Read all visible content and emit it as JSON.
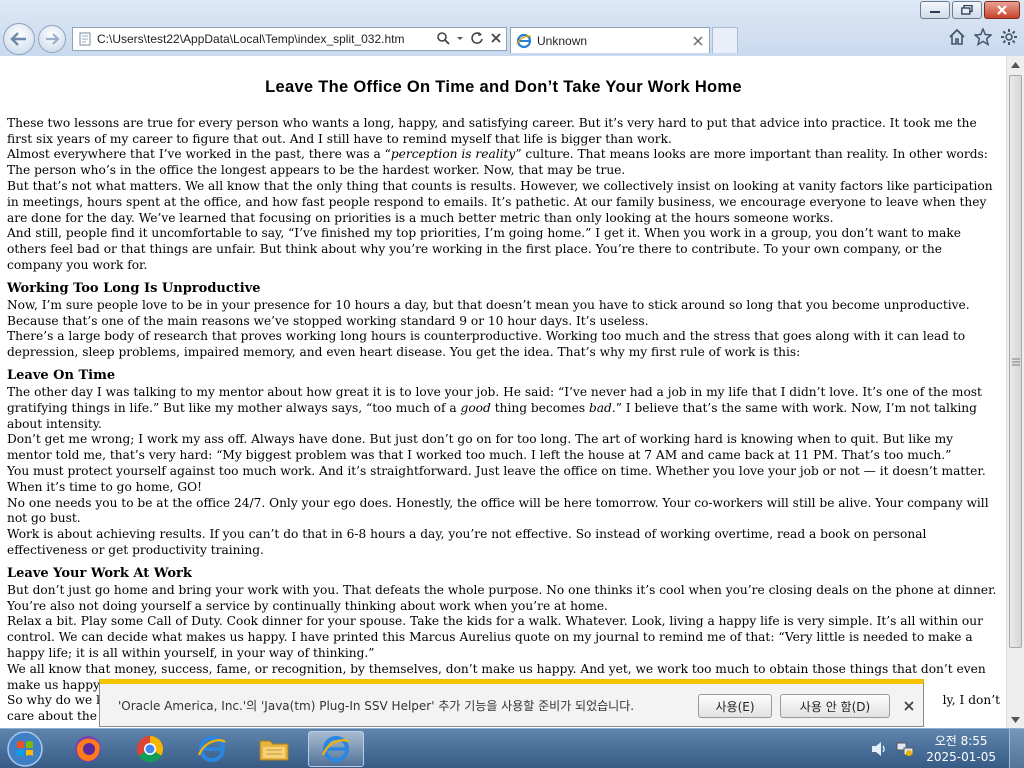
{
  "browser": {
    "address": "C:\\Users\\test22\\AppData\\Local\\Temp\\index_split_032.htm",
    "tab_title": "Unknown",
    "colors": {
      "chrome": "#c9d9ee",
      "close_button": "#c8432c",
      "notification_accent": "#f3c200"
    }
  },
  "article": {
    "title": "Leave The Office On Time and Don’t Take Your Work Home",
    "intro": [
      "These two lessons are true for every person who wants a long, happy, and satisfying career. But it’s very hard to put that advice into practice. It took me the first six years of my career to figure that out. And I still have to remind myself that life is bigger than work.",
      "Almost everywhere that I’ve worked in the past, there was a “",
      "perception is reality",
      "” culture. That means looks are more important than reality. In other words: The person who’s in the office the longest appears to be the hardest worker. Now, that may be true.",
      "But that’s not what matters. We all know that the only thing that counts is results. However, we collectively insist on looking at vanity factors like participation in meetings, hours spent at the office, and how fast people respond to emails. It’s pathetic. At our family business, we encourage everyone to leave when they are done for the day. We’ve learned that focusing on priorities is a much better metric than only looking at the hours someone works.",
      "And still, people find it uncomfortable to say, “I’ve finished my top priorities, I’m going home.” I get it. When you work in a group, you don’t want to make others feel bad or that things are unfair. But think about why you’re working in the first place. You’re there to contribute. To your own company, or the company you work for."
    ],
    "section1": {
      "heading": "Working Too Long Is Unproductive",
      "p1": "Now, I’m sure people love to be in your presence for 10 hours a day, but that doesn’t mean you have to stick around so long that you become unproductive. Because that’s one of the main reasons we’ve stopped working standard 9 or 10 hour days. It’s useless.",
      "p2": "There’s a large body of research that proves working long hours is counterproductive. Working too much and the stress that goes along with it can lead to depression, sleep problems, impaired memory, and even heart disease. You get the idea. That’s why my first rule of work is this:"
    },
    "section2": {
      "heading": "Leave On Time",
      "p1a": "The other day I was talking to my mentor about how great it is to love your job. He said: “I’ve never had a job in my life that I didn’t love. It’s one of the most gratifying things in life.” But like my mother always says, “too much of a ",
      "p1_good": "good",
      "p1b": " thing becomes ",
      "p1_bad": "bad",
      "p1c": ".” I believe that’s the same with work. Now, I’m not talking about intensity.",
      "p2": "Don’t get me wrong; I work my ass off. Always have done. But just don’t go on for too long. The art of working hard is knowing when to quit. But like my mentor told me, that’s very hard: “My biggest problem was that I worked too much. I left the house at 7 AM and came back at 11 PM. That’s too much.”",
      "p3": "You must protect yourself against too much work. And it’s straightforward. Just leave the office on time. Whether you love your job or not — it doesn’t matter. When it’s time to go home, GO!",
      "p4": "No one needs you to be at the office 24/7. Only your ego does. Honestly, the office will be here tomorrow. Your co-workers will still be alive. Your company will not go bust.",
      "p5": "Work is about achieving results. If you can’t do that in 6-8 hours a day, you’re not effective. So instead of working overtime, read a book on personal effectiveness or get productivity training."
    },
    "section3": {
      "heading": "Leave Your Work At Work",
      "p1": "But don’t just go home and bring your work with you. That defeats the whole purpose. No one thinks it’s cool when you’re closing deals on the phone at dinner. You’re also not doing yourself a service by continually thinking about work when you’re at home.",
      "p2": "Relax a bit. Play some Call of Duty. Cook dinner for your spouse. Take the kids for a walk. Whatever. Look, living a happy life is very simple. It’s all within our control. We can decide what makes us happy. I have printed this Marcus Aurelius quote on my journal to remind me of that: “Very little is needed to make a happy life; it is all within yourself, in your way of thinking.”",
      "p3": "We all know that money, success, fame, or recognition, by themselves, don’t make us happy. And yet, we work too much to obtain those things that don’t even make us happy",
      "p4_left": "So why do we k",
      "p4_right": "ly, I don’t",
      "p5_left": "care about the"
    }
  },
  "notification": {
    "message": "'Oracle America, Inc.'의 'Java(tm) Plug-In SSV Helper' 추가 기능을 사용할 준비가 되었습니다.",
    "enable_label": "사용(E)",
    "disable_label": "사용 안 함(D)"
  },
  "taskbar": {
    "time": "오전 8:55",
    "date": "2025-01-05"
  }
}
